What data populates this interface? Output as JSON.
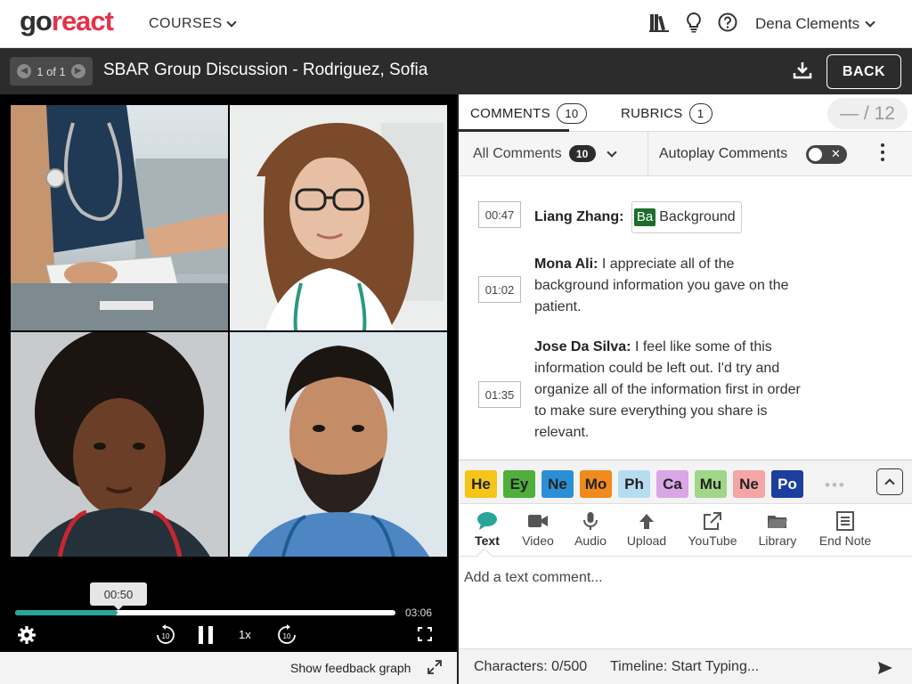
{
  "nav": {
    "logo_go": "go",
    "logo_react": "react",
    "courses_label": "COURSES",
    "user_name": "Dena Clements",
    "icons": [
      "library-icon",
      "lightbulb-icon",
      "help-icon"
    ]
  },
  "titlebar": {
    "pager": "1 of 1",
    "title": "SBAR Group Discussion - Rodriguez, Sofia",
    "back_label": "BACK"
  },
  "video": {
    "tooltip_time": "00:50",
    "duration": "03:06",
    "progress": 0.27,
    "speed": "1x",
    "skip_back": "10",
    "skip_forward": "10",
    "feedback_label": "Show feedback graph"
  },
  "tabs": {
    "comments_label": "COMMENTS",
    "comments_count": "10",
    "rubrics_label": "RUBRICS",
    "rubrics_count": "1",
    "score": "— / 12"
  },
  "filter": {
    "label": "All Comments",
    "count": "10",
    "autoplay_label": "Autoplay Comments"
  },
  "comments": [
    {
      "time": "00:47",
      "author": "Liang Zhang:",
      "text": "",
      "tag_abbr": "Ba",
      "tag_label": "Background"
    },
    {
      "time": "01:02",
      "author": "Mona Ali:",
      "text": "I appreciate all of the background information you gave on the patient."
    },
    {
      "time": "01:35",
      "author": "Jose Da Silva:",
      "text": "I feel like some of this information could be left out. I'd try and organize all of the information first in order to make sure everything you share is relevant."
    }
  ],
  "tags": [
    {
      "abbr": "He",
      "color": "#f5c518"
    },
    {
      "abbr": "Ey",
      "color": "#4fae3c"
    },
    {
      "abbr": "Ne",
      "color": "#2b8fd6"
    },
    {
      "abbr": "Mo",
      "color": "#f08a1c"
    },
    {
      "abbr": "Ph",
      "color": "#b6dcf0"
    },
    {
      "abbr": "Ca",
      "color": "#d9a6e6"
    },
    {
      "abbr": "Mu",
      "color": "#9fd68a"
    },
    {
      "abbr": "Ne",
      "color": "#f4a6a6"
    },
    {
      "abbr": "Po",
      "color": "#1c3f9e"
    }
  ],
  "tools": [
    {
      "label": "Text",
      "icon": "speech-bubble-icon"
    },
    {
      "label": "Video",
      "icon": "video-camera-icon"
    },
    {
      "label": "Audio",
      "icon": "microphone-icon"
    },
    {
      "label": "Upload",
      "icon": "upload-arrow-icon"
    },
    {
      "label": "YouTube",
      "icon": "external-link-icon"
    },
    {
      "label": "Library",
      "icon": "folder-icon"
    },
    {
      "label": "End Note",
      "icon": "document-icon"
    }
  ],
  "composer": {
    "placeholder": "Add a text comment...",
    "characters": "Characters: 0/500",
    "timeline": "Timeline:  Start Typing..."
  },
  "colors": {
    "brand_red": "#e0334a",
    "progress_teal": "#2aa59a",
    "dark_bar": "#2c2c2c"
  }
}
